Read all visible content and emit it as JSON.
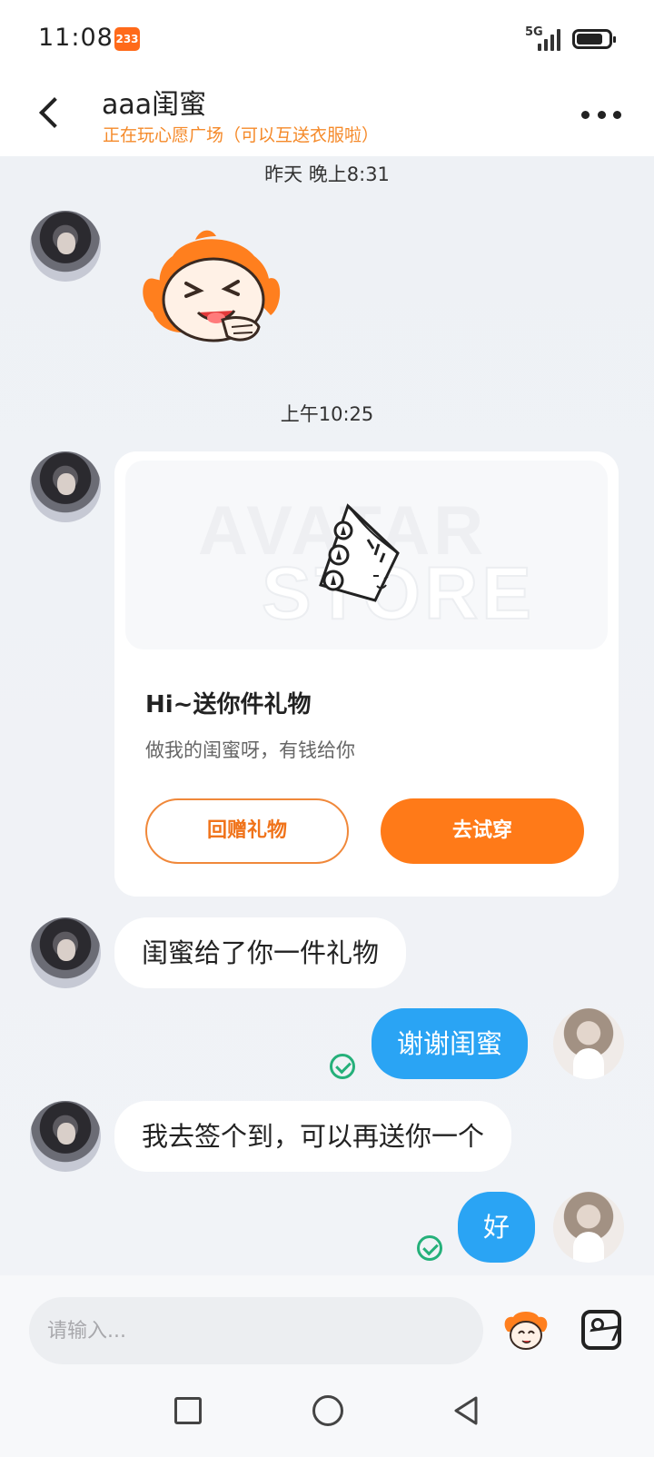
{
  "status_bar": {
    "time": "11:08",
    "badge": "233",
    "network": "5G"
  },
  "header": {
    "title": "aaa闺蜜",
    "subtitle": "正在玩心愿广场（可以互送衣服啦）"
  },
  "chat": {
    "timestamp_1": "昨天 晚上8:31",
    "timestamp_2": "上午10:25",
    "gift_card": {
      "watermark_top": "AVATAR",
      "watermark_bottom": "STORE",
      "title": "Hi~送你件礼物",
      "description": "做我的闺蜜呀，有钱给你",
      "return_gift_label": "回赠礼物",
      "try_on_label": "去试穿"
    },
    "messages": [
      {
        "side": "left",
        "text": "闺蜜给了你一件礼物"
      },
      {
        "side": "right",
        "text": "谢谢闺蜜",
        "status": "sent"
      },
      {
        "side": "left",
        "text": "我去签个到，可以再送你一个"
      },
      {
        "side": "right",
        "text": "好",
        "status": "sent"
      }
    ]
  },
  "input_bar": {
    "placeholder": "请输入..."
  },
  "colors": {
    "accent_orange": "#ff7a18",
    "bubble_blue": "#2aa4f4",
    "subtitle_orange": "#f58a2a",
    "check_green": "#25b07a"
  },
  "icons": {
    "back": "back-arrow-icon",
    "more": "more-dots-icon",
    "emoji": "mascot-emoji-icon",
    "image": "image-picker-icon",
    "sent": "check-circle-icon"
  }
}
